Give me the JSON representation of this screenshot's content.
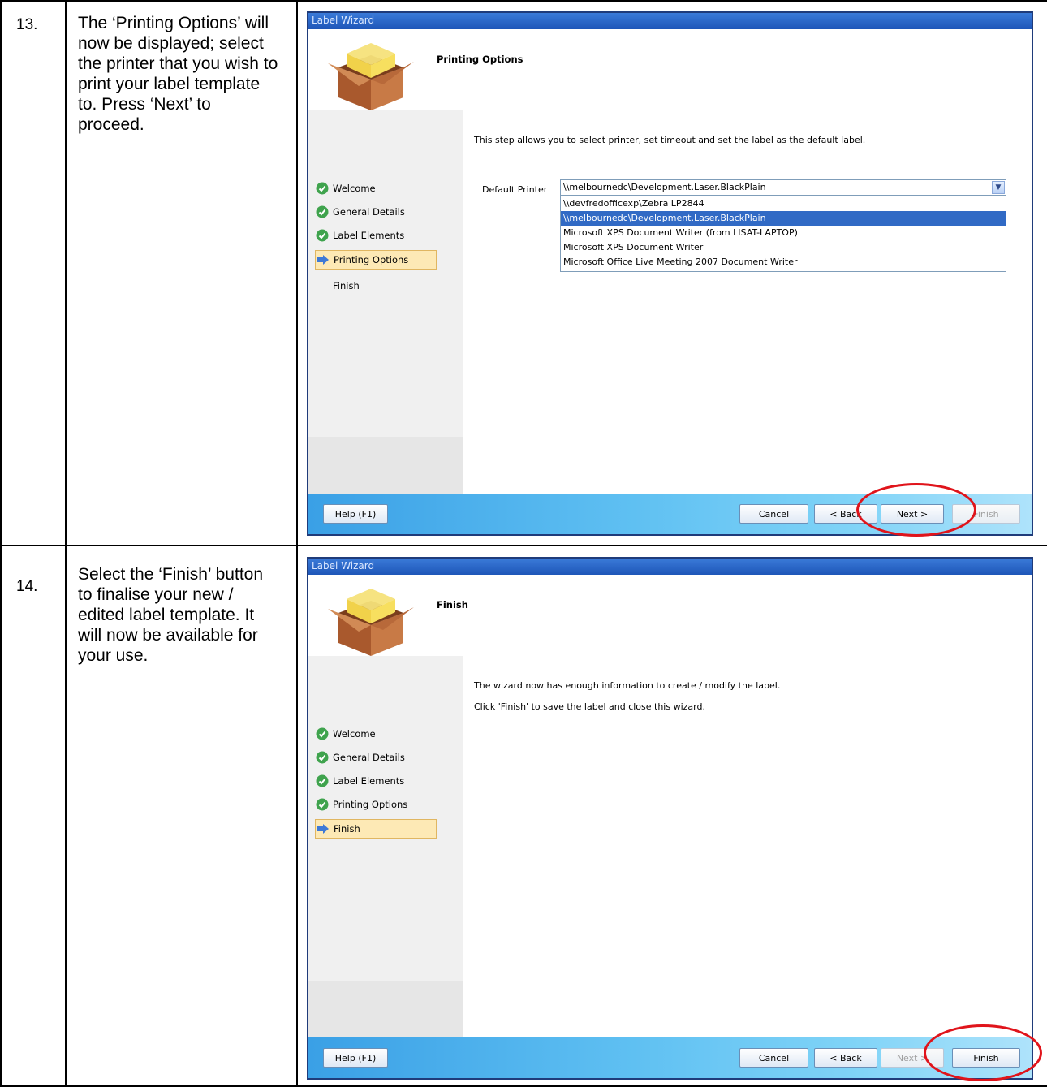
{
  "steps": [
    {
      "number": "13.",
      "text": "The ‘Printing Options’ will now be displayed; select the printer that you wish to print your label template to. Press ‘Next’ to proceed.",
      "wizard": {
        "window_title": "Label Wizard",
        "page_title": "Printing Options",
        "nav": [
          "Welcome",
          "General Details",
          "Label Elements",
          "Printing Options",
          "Finish"
        ],
        "description": "This step allows you to select printer, set timeout and set the label as the default  label.",
        "printer_label": "Default Printer",
        "printer_value": "\\\\melbournedc\\Development.Laser.BlackPlain",
        "printer_options": [
          "\\\\devfredofficexp\\Zebra LP2844",
          "\\\\melbournedc\\Development.Laser.BlackPlain",
          "Microsoft XPS Document Writer (from LISAT-LAPTOP)",
          "Microsoft XPS Document Writer",
          "Microsoft Office Live Meeting 2007 Document Writer"
        ],
        "buttons": {
          "help": "Help (F1)",
          "cancel": "Cancel",
          "back": "< Back",
          "next": "Next >",
          "finish": "Finish"
        }
      }
    },
    {
      "number": "14.",
      "text": "Select the ‘Finish’ button to finalise your new / edited label template. It will now be available for your use.",
      "wizard": {
        "window_title": "Label Wizard",
        "page_title": "Finish",
        "nav": [
          "Welcome",
          "General Details",
          "Label Elements",
          "Printing Options",
          "Finish"
        ],
        "line1": "The wizard now has enough information to create / modify the label.",
        "line2": "Click 'Finish' to save the label and close this wizard.",
        "buttons": {
          "help": "Help (F1)",
          "cancel": "Cancel",
          "back": "< Back",
          "next": "Next >",
          "finish": "Finish"
        }
      }
    }
  ],
  "colors": {
    "highlight_ellipse": "#e0141b",
    "nav_active": "#fde9b5",
    "selected_option": "#316ac5"
  }
}
